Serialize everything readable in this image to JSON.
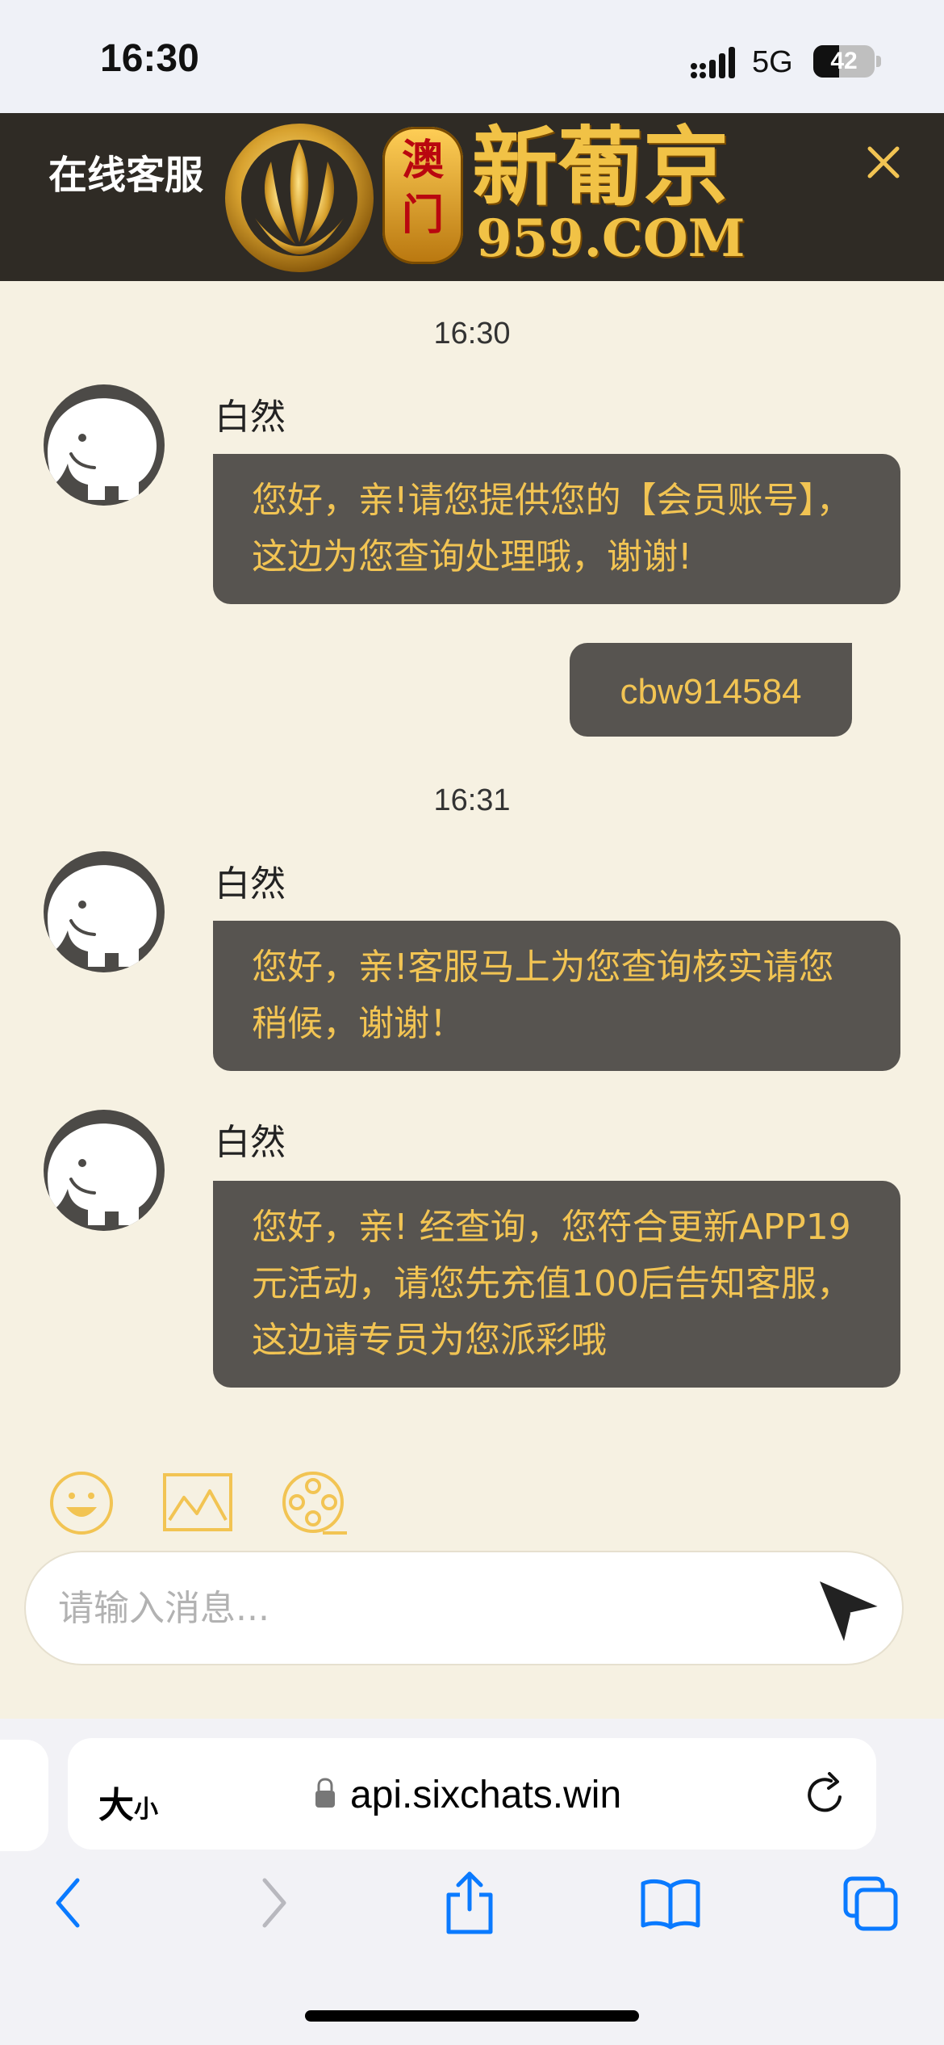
{
  "status_bar": {
    "time": "16:30",
    "network": "5G",
    "battery": "42"
  },
  "header": {
    "title": "在线客服",
    "logo_macau": "澳门",
    "logo_brand": "新葡京",
    "logo_domain": "959.COM"
  },
  "chat": {
    "messages": [
      {
        "type": "timestamp",
        "text": "16:30"
      },
      {
        "type": "incoming",
        "sender": "白然",
        "text": "您好，亲!请您提供您的【会员账号】，这边为您查询处理哦，谢谢!"
      },
      {
        "type": "outgoing",
        "text": "cbw914584"
      },
      {
        "type": "timestamp",
        "text": "16:31"
      },
      {
        "type": "incoming",
        "sender": "白然",
        "text": "您好，亲!客服马上为您查询核实请您稍候，谢谢！"
      },
      {
        "type": "incoming",
        "sender": "白然",
        "text": "您好，亲! 经查询，您符合更新APP19元活动，请您先充值100后告知客服，这边请专员为您派彩哦"
      }
    ]
  },
  "composer": {
    "placeholder": "请输入消息..."
  },
  "browser": {
    "text_size_large": "大",
    "text_size_small": "小",
    "url": "api.sixchats.win"
  },
  "colors": {
    "accent": "#f2c453",
    "bubble": "#575450",
    "chat_bg": "#f6f1e2",
    "header_bg": "#2f2b25",
    "ios_blue": "#0a7aff"
  }
}
